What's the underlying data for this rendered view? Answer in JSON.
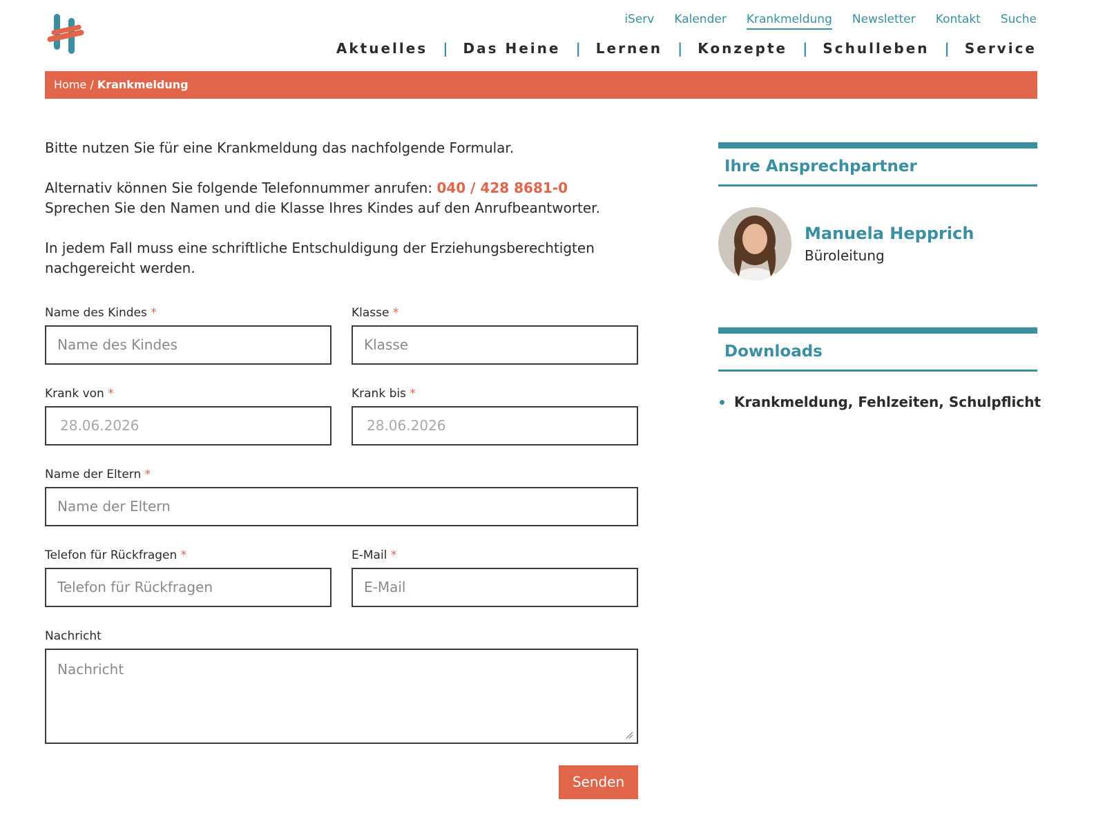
{
  "topnav": [
    "iServ",
    "Kalender",
    "Krankmeldung",
    "Newsletter",
    "Kontakt",
    "Suche"
  ],
  "topnav_active": "Krankmeldung",
  "mainnav": [
    "Aktuelles",
    "Das Heine",
    "Lernen",
    "Konzepte",
    "Schulleben",
    "Service"
  ],
  "breadcrumb": {
    "home": "Home",
    "separator": " / ",
    "current": "Krankmeldung"
  },
  "intro": {
    "p1": "Bitte nutzen Sie für eine Krankmeldung das nachfolgende Formular.",
    "p2_prefix": "Alternativ können Sie folgende Telefonnummer anrufen: ",
    "phone": "040 / 428 8681-0",
    "p2_line2": "Sprechen Sie den Namen und die Klasse Ihres Kindes auf den Anrufbeantworter.",
    "p3": "In jedem Fall muss eine schriftliche Entschuldigung der Erziehungsberechtigten nachgereicht werden."
  },
  "form": {
    "child_name": {
      "label": "Name des Kindes",
      "placeholder": "Name des Kindes"
    },
    "klasse": {
      "label": "Klasse",
      "placeholder": "Klasse"
    },
    "krank_von": {
      "label": "Krank von",
      "value": "28.06.2026"
    },
    "krank_bis": {
      "label": "Krank bis",
      "value": "28.06.2026"
    },
    "eltern": {
      "label": "Name der Eltern",
      "placeholder": "Name der Eltern"
    },
    "telefon": {
      "label": "Telefon für Rückfragen",
      "placeholder": "Telefon für Rückfragen"
    },
    "email": {
      "label": "E-Mail",
      "placeholder": "E-Mail"
    },
    "nachricht": {
      "label": "Nachricht",
      "placeholder": "Nachricht"
    },
    "required_mark": "*",
    "submit": "Senden"
  },
  "sidebar": {
    "contacts_title": "Ihre Ansprechpartner",
    "contact_name": "Manuela Hepprich",
    "contact_role": "Büroleitung",
    "downloads_title": "Downloads",
    "downloads": [
      "Krankmeldung, Fehlzeiten, Schulpflicht"
    ]
  },
  "colors": {
    "accent": "#e0654a",
    "teal": "#3a8fa0",
    "text": "#2b2b2b"
  }
}
